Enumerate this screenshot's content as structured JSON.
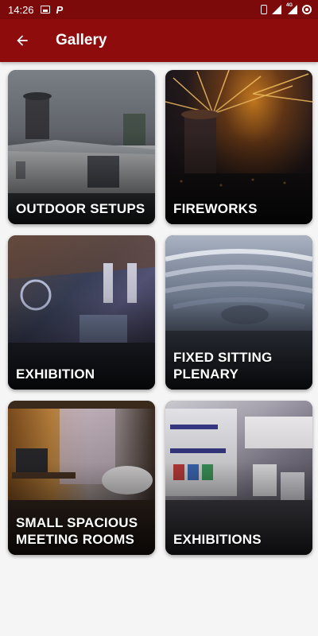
{
  "status_bar": {
    "time": "14:26"
  },
  "app_bar": {
    "title": "Gallery"
  },
  "gallery": [
    {
      "label": "OUTDOOR SETUPS"
    },
    {
      "label": "FIREWORKS"
    },
    {
      "label": "EXHIBITION"
    },
    {
      "label": "FIXED SITTING PLENARY"
    },
    {
      "label": "SMALL SPACIOUS MEETING ROOMS"
    },
    {
      "label": "EXHIBITIONS"
    }
  ],
  "colors": {
    "status_bar": "#7d0a0a",
    "app_bar": "#8e0c0c",
    "background": "#f5f5f5"
  },
  "icons": {
    "back": "arrow-back-icon"
  }
}
